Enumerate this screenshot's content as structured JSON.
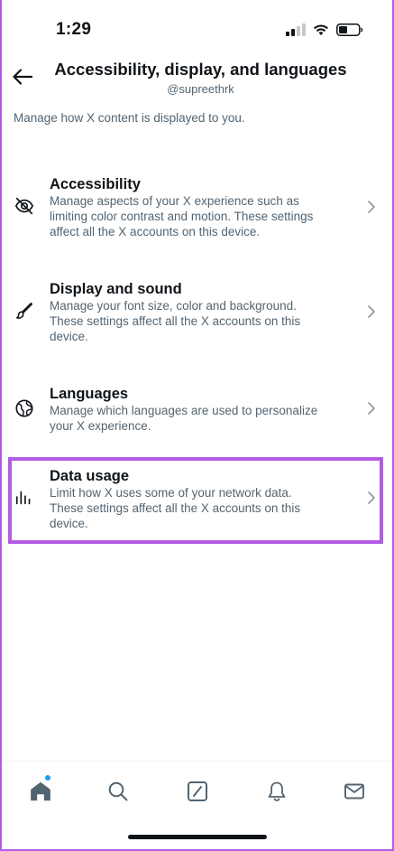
{
  "status_bar": {
    "time": "1:29"
  },
  "header": {
    "title": "Accessibility, display, and languages",
    "subtitle": "@supreethrk"
  },
  "description": "Manage how X content is displayed to you.",
  "settings": [
    {
      "title": "Accessibility",
      "lines": [
        "Manage aspects of your X experience such as",
        "limiting color contrast and motion. These settings",
        "affect all the X accounts on this device."
      ],
      "icon": "eye-slash-icon"
    },
    {
      "title": "Display and sound",
      "lines": [
        "Manage your font size, color and background.",
        "These settings affect all the X accounts on this",
        "device."
      ],
      "icon": "brush-icon"
    },
    {
      "title": "Languages",
      "lines": [
        "Manage which languages are used to personalize",
        "your X experience."
      ],
      "icon": "globe-icon"
    },
    {
      "title": "Data usage",
      "lines": [
        "Limit how X uses some of your network data.",
        "These settings affect all the X accounts on this",
        "device."
      ],
      "icon": "bar-chart-icon"
    }
  ],
  "bottom_nav": [
    "home-icon",
    "search-icon",
    "compose-icon",
    "bell-icon",
    "mail-icon"
  ],
  "colors": {
    "text": "#0f1419",
    "secondary": "#536471",
    "highlight": "#b25ce6",
    "accent": "#1d9bf0"
  }
}
